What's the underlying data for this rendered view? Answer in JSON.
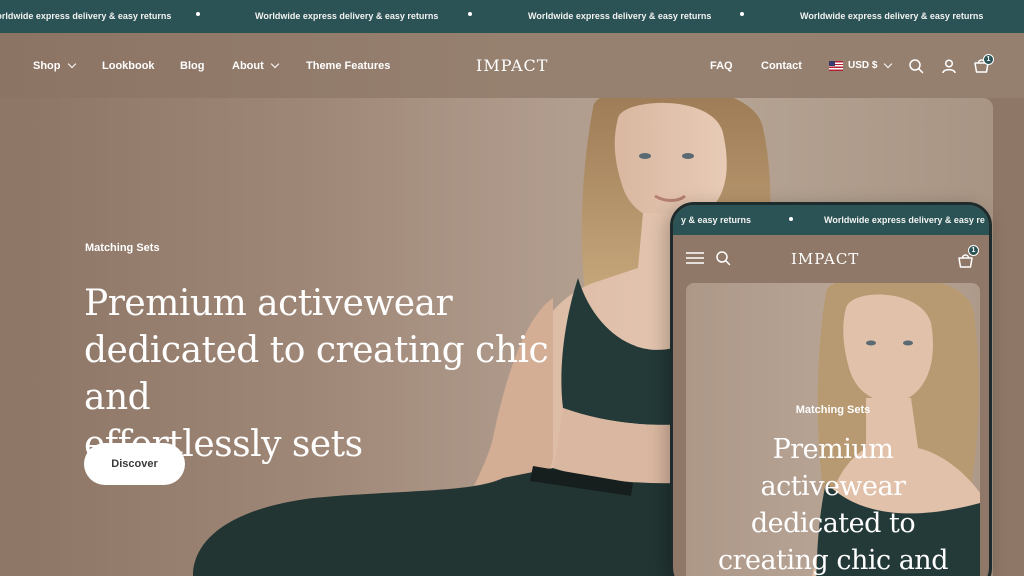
{
  "announcement": {
    "messages": [
      "Worldwide express delivery & easy returns",
      "Worldwide express delivery & easy returns",
      "Worldwide express delivery & easy returns",
      "Worldwide express delivery & easy returns"
    ],
    "clipped_fragment": "Worldwide express delivery & easy returns"
  },
  "header": {
    "nav_left": [
      "Shop",
      "Lookbook",
      "Blog",
      "About",
      "Theme Features"
    ],
    "logo": "IMPACT",
    "nav_right": [
      "FAQ",
      "Contact"
    ],
    "currency": "USD $",
    "cart_count": "1"
  },
  "hero": {
    "eyebrow": "Matching Sets",
    "title_lines": [
      "Premium activewear",
      "dedicated to creating chic and",
      "effortlessly sets"
    ],
    "button": "Discover"
  },
  "mobile": {
    "announcement": [
      "y & easy returns",
      "Worldwide express delivery & easy re"
    ],
    "logo": "IMPACT",
    "cart_count": "1",
    "eyebrow": "Matching Sets",
    "title_lines": [
      "Premium",
      "activewear",
      "dedicated to",
      "creating chic and"
    ]
  },
  "icons": {
    "search": "search-icon",
    "account": "account-icon",
    "cart": "cart-icon",
    "menu": "hamburger-icon",
    "flag": "us-flag-icon"
  },
  "colors": {
    "announcement_bg": "#2b5254",
    "header_bg": "#8f7767",
    "button_bg": "#ffffff"
  }
}
